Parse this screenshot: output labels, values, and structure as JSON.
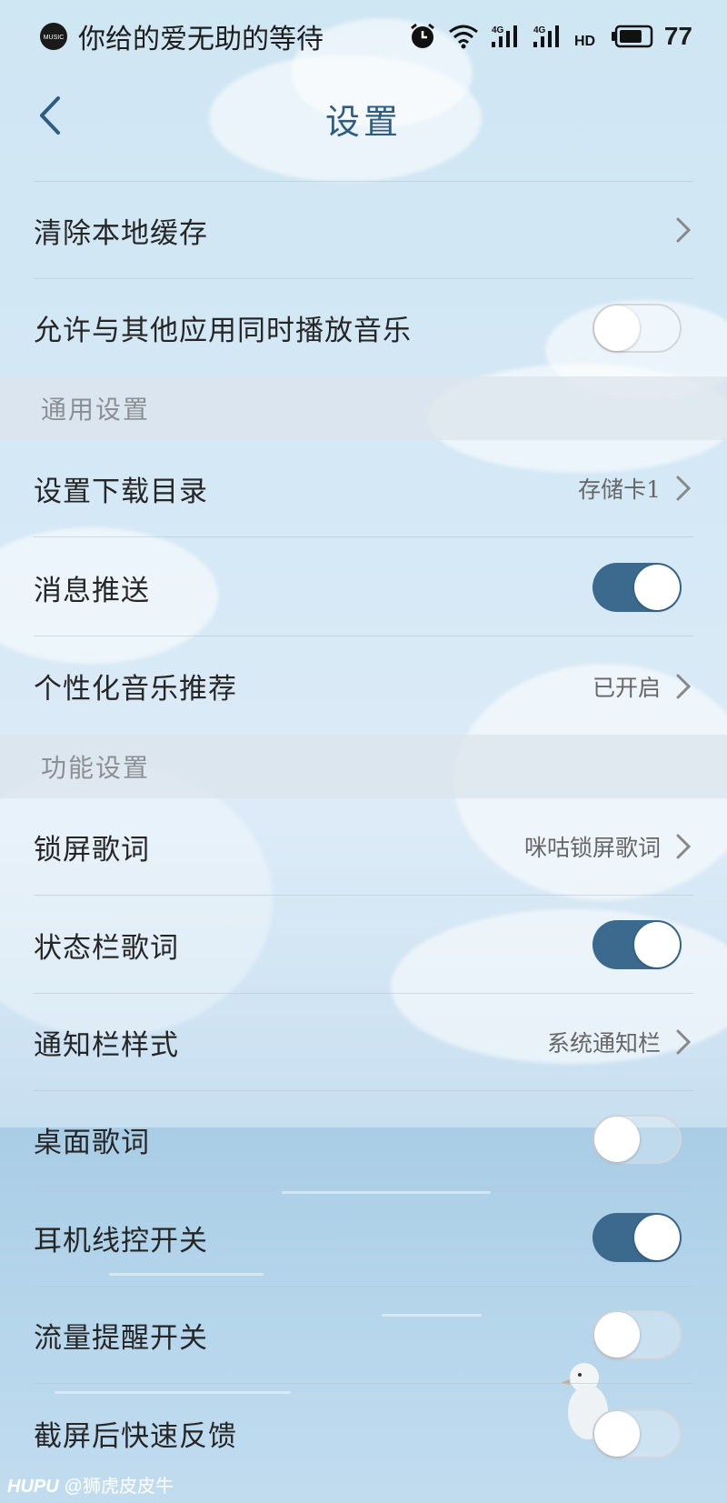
{
  "status_bar": {
    "now_playing": "你给的爱无助的等待",
    "music_icon_label": "MUSIC",
    "network_1": "4G",
    "network_2": "4G",
    "hd_label": "HD",
    "battery": "77",
    "battery_level": 0.77
  },
  "header": {
    "title": "设置"
  },
  "rows": [
    {
      "label": "清除本地缓存",
      "type": "link"
    },
    {
      "label": "允许与其他应用同时播放音乐",
      "type": "toggle",
      "on": false
    }
  ],
  "sections": [
    {
      "title": "通用设置"
    },
    {
      "title": "功能设置"
    }
  ],
  "general": [
    {
      "label": "设置下载目录",
      "value": "存储卡1",
      "type": "link"
    },
    {
      "label": "消息推送",
      "type": "toggle",
      "on": true
    },
    {
      "label": "个性化音乐推荐",
      "value": "已开启",
      "type": "link"
    }
  ],
  "function": [
    {
      "label": "锁屏歌词",
      "value": "咪咕锁屏歌词",
      "type": "link"
    },
    {
      "label": "状态栏歌词",
      "type": "toggle",
      "on": true
    },
    {
      "label": "通知栏样式",
      "value": "系统通知栏",
      "type": "link"
    },
    {
      "label": "桌面歌词",
      "type": "toggle",
      "on": false
    },
    {
      "label": "耳机线控开关",
      "type": "toggle",
      "on": true
    },
    {
      "label": "流量提醒开关",
      "type": "toggle",
      "on": false
    },
    {
      "label": "截屏后快速反馈",
      "type": "toggle",
      "on": false
    }
  ],
  "watermark": {
    "brand": "HUPU",
    "author": "@狮虎皮皮牛"
  },
  "colors": {
    "accent": "#3b6a8e",
    "title": "#2f5d82"
  }
}
